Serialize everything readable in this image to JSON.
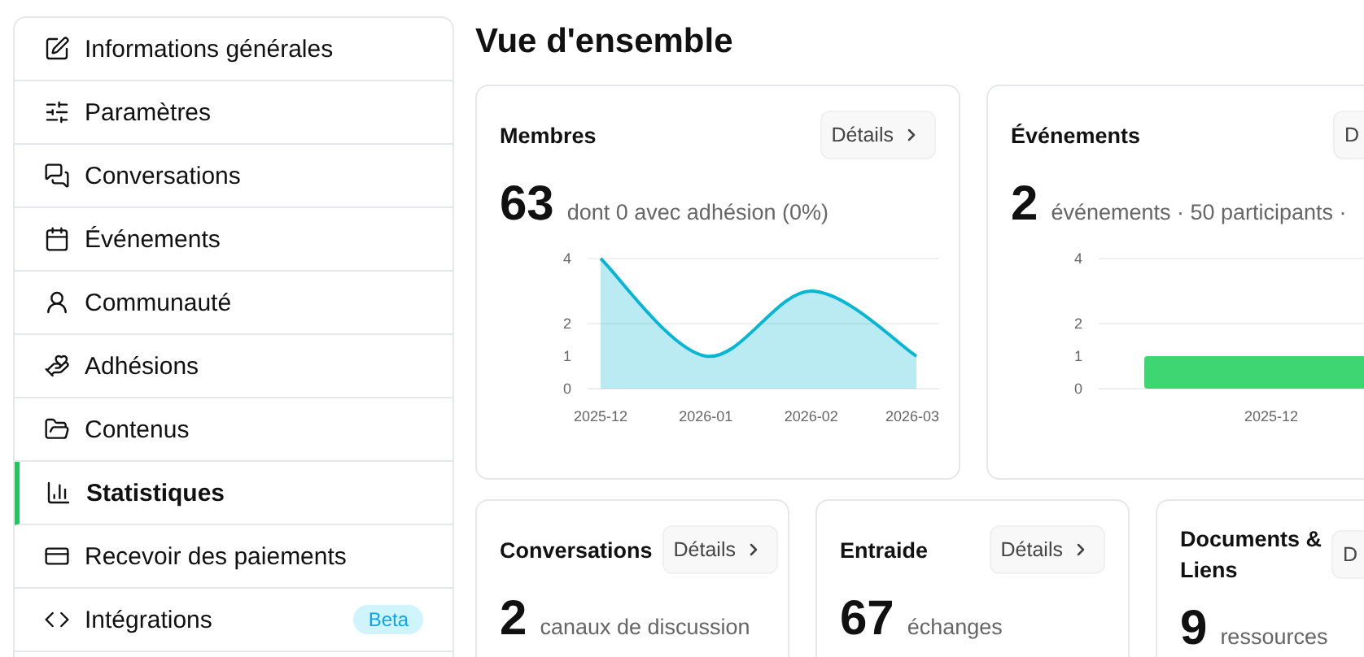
{
  "sidebar": {
    "items": [
      {
        "label": "Informations générales",
        "selected": false
      },
      {
        "label": "Paramètres",
        "selected": false
      },
      {
        "label": "Conversations",
        "selected": false
      },
      {
        "label": "Événements",
        "selected": false
      },
      {
        "label": "Communauté",
        "selected": false
      },
      {
        "label": "Adhésions",
        "selected": false
      },
      {
        "label": "Contenus",
        "selected": false
      },
      {
        "label": "Statistiques",
        "selected": true
      },
      {
        "label": "Recevoir des paiements",
        "selected": false
      },
      {
        "label": "Intégrations",
        "selected": false,
        "badge": "Beta"
      }
    ]
  },
  "page_title": "Vue d'ensemble",
  "cards": [
    {
      "title": "Membres",
      "button": "Détails",
      "chevron": true,
      "value": "63",
      "subtitle": "dont 0 avec adhésion (0%)",
      "chart_data": {
        "type": "area",
        "categories": [
          "2025-12",
          "2026-01",
          "2026-02",
          "2026-03"
        ],
        "series": [
          {
            "color": "#06b6d4",
            "values": [
              4,
              1,
              3,
              1
            ]
          }
        ],
        "ylim": [
          0,
          4
        ],
        "yticks": [
          0,
          1,
          2,
          4
        ]
      }
    },
    {
      "title": "Événements",
      "button": "D",
      "value": "2",
      "subtitle": "événements · 50 participants ·",
      "chart_data": {
        "type": "bar",
        "categories": [
          "2025-12"
        ],
        "series": [
          {
            "color": "#3dd672",
            "values": [
              1
            ]
          }
        ],
        "ylim": [
          0,
          4
        ],
        "yticks": [
          0,
          1,
          2,
          4
        ]
      }
    },
    {
      "title": "Conversations",
      "button": "Détails",
      "chevron": true,
      "value": "2",
      "subtitle": "canaux de discussion"
    },
    {
      "title": "Entraide",
      "button": "Détails",
      "chevron": true,
      "value": "67",
      "subtitle": "échanges"
    },
    {
      "title": "Documents & Liens",
      "button": "D",
      "value": "9",
      "subtitle": "ressources"
    }
  ]
}
